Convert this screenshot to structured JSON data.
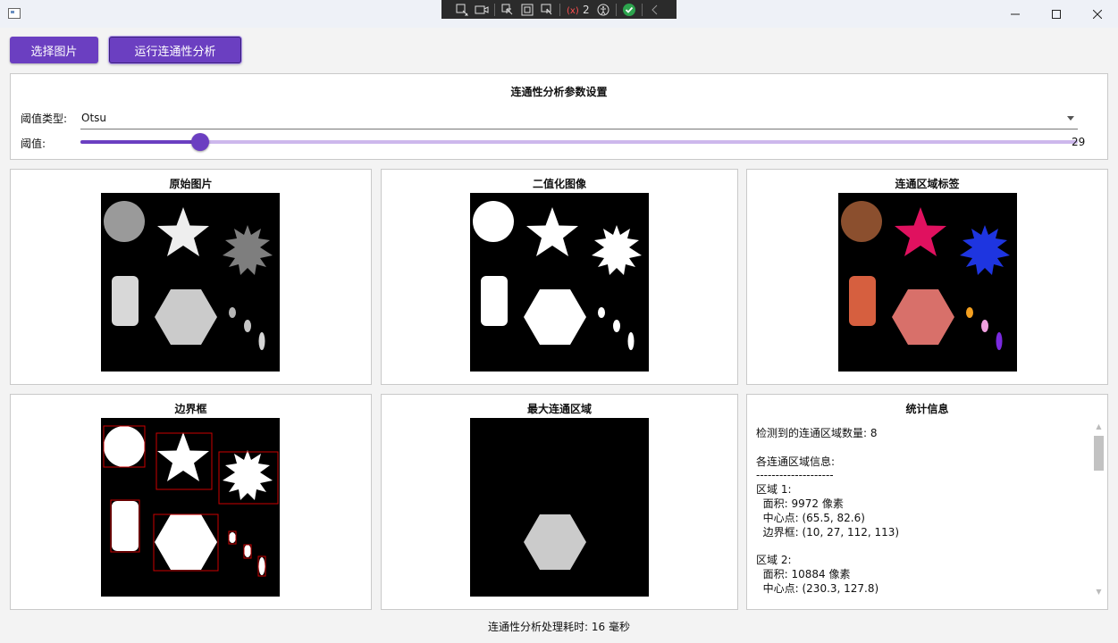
{
  "toolbar": {
    "select_image_label": "选择图片",
    "run_analysis_label": "运行连通性分析",
    "debug_counter": "2"
  },
  "params": {
    "title": "连通性分析参数设置",
    "threshold_type_label": "阈值类型:",
    "threshold_type_value": "Otsu",
    "threshold_label": "阈值:",
    "threshold_value": "29",
    "threshold_fraction": 0.12
  },
  "panels": {
    "original_title": "原始图片",
    "binary_title": "二值化图像",
    "labels_title": "连通区域标签",
    "bbox_title": "边界框",
    "largest_title": "最大连通区域",
    "stats_title": "统计信息"
  },
  "stats": {
    "lines": [
      "检测到的连通区域数量: 8",
      "",
      "各连通区域信息:",
      "--------------------",
      "区域 1:",
      "  面积: 9972 像素",
      "  中心点: (65.5, 82.6)",
      "  边界框: (10, 27, 112, 113)",
      "",
      "区域 2:",
      "  面积: 10884 像素",
      "  中心点: (230.3, 127.8)"
    ]
  },
  "status": {
    "text": "连通性分析处理耗时: 16 毫秒"
  },
  "colors": {
    "accent": "#6b3fc1",
    "slider_track": "#cdb8ec",
    "label_circle": "#8b4f2e",
    "label_star": "#e0115f",
    "label_burst": "#1e35e0",
    "label_rect": "#d65f3f",
    "label_hexagon": "#d8706a",
    "label_dot1": "#f5a020",
    "label_dot2": "#f0a0e0",
    "label_dot3": "#7a2ae0",
    "bbox_stroke": "#cc0000"
  }
}
